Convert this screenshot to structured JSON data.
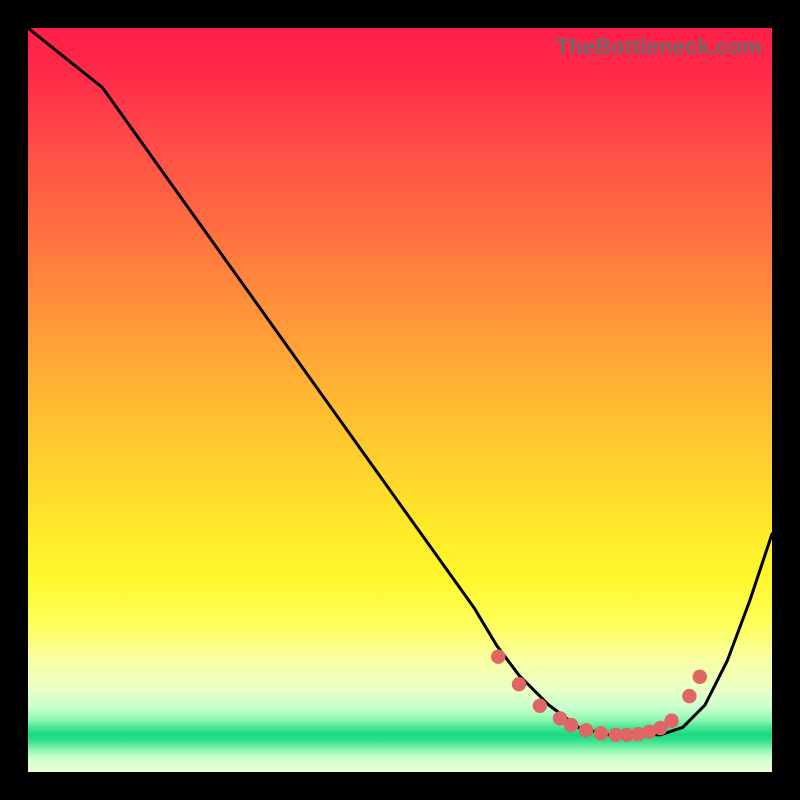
{
  "watermark": "TheBottleneck.com",
  "colors": {
    "dot": "#e06666",
    "curve": "#000000"
  },
  "chart_data": {
    "type": "line",
    "title": "",
    "xlabel": "",
    "ylabel": "",
    "xlim": [
      0,
      100
    ],
    "ylim": [
      0,
      100
    ],
    "grid": false,
    "legend": false,
    "series": [
      {
        "name": "bottleneck-curve",
        "x": [
          0,
          5,
          10,
          15,
          20,
          25,
          30,
          35,
          40,
          45,
          50,
          55,
          60,
          63,
          66,
          70,
          74,
          78,
          82,
          85,
          88,
          91,
          94,
          97,
          100
        ],
        "y": [
          100,
          96,
          92,
          85,
          78,
          71,
          64,
          57,
          50,
          43,
          36,
          29,
          22,
          17,
          13,
          9,
          6,
          5,
          5,
          5,
          6,
          9,
          15,
          23,
          32
        ]
      }
    ],
    "markers": {
      "name": "highlight-dots",
      "x": [
        63.2,
        66.0,
        68.8,
        71.5,
        73.0,
        75.0,
        77.0,
        79.0,
        80.5,
        82.0,
        83.5,
        85.0,
        86.5,
        88.9,
        90.3
      ],
      "y": [
        15.5,
        11.8,
        8.9,
        7.2,
        6.3,
        5.6,
        5.2,
        5.0,
        5.0,
        5.1,
        5.4,
        5.9,
        6.9,
        10.2,
        12.8
      ]
    }
  }
}
